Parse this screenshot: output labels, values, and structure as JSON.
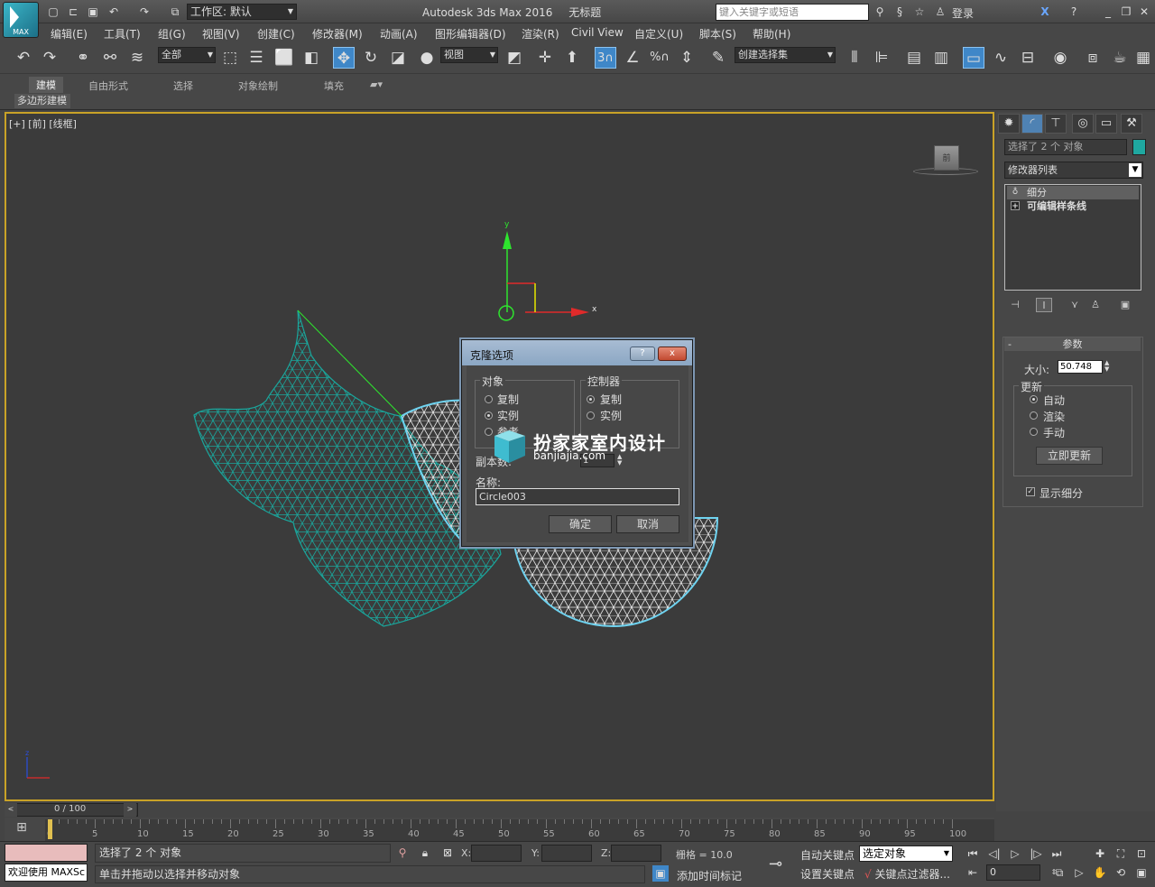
{
  "title_bar": {
    "logo_text": "MAX",
    "workspace_label": "工作区: 默认",
    "app_title": "Autodesk 3ds Max 2016",
    "doc_title": "无标题",
    "search_placeholder": "键入关键字或短语",
    "login_label": "登录"
  },
  "menu": [
    "编辑(E)",
    "工具(T)",
    "组(G)",
    "视图(V)",
    "创建(C)",
    "修改器(M)",
    "动画(A)",
    "图形编辑器(D)",
    "渲染(R)",
    "Civil View",
    "自定义(U)",
    "脚本(S)",
    "帮助(H)"
  ],
  "toolbar": {
    "filter_value": "全部",
    "ref_coord_value": "视图",
    "selection_set_placeholder": "创建选择集",
    "snap_number": "3"
  },
  "ribbon": {
    "tabs": [
      "建模",
      "自由形式",
      "选择",
      "对象绘制",
      "填充"
    ],
    "active_tab": "建模",
    "sub_panel": "多边形建模"
  },
  "viewport": {
    "label": "[+] [前] [线框]",
    "viewcube_face": "前",
    "gizmo_x": "x",
    "gizmo_y": "y",
    "corner_z": "z"
  },
  "command_panel": {
    "object_name": "选择了 2 个 对象",
    "object_color": "#1fa8a0",
    "modifier_list": "修改器列表",
    "stack": [
      {
        "label": "细分",
        "selected": true,
        "icon": "bulb-icon"
      },
      {
        "label": "可编辑样条线",
        "selected": false,
        "icon": "plus-icon"
      }
    ],
    "rollout_title": "参数",
    "size_label": "大小:",
    "size_value": "50.748",
    "update_title": "更新",
    "update_options": [
      "自动",
      "渲染",
      "手动"
    ],
    "update_selected": "自动",
    "update_now": "立即更新",
    "show_subdivision": "显示细分",
    "show_subdivision_checked": true
  },
  "clone_dialog": {
    "title": "克隆选项",
    "help_glyph": "?",
    "close_glyph": "x",
    "object_group": "对象",
    "object_options": [
      "复制",
      "实例",
      "参考"
    ],
    "object_selected": "实例",
    "controller_group": "控制器",
    "controller_options": [
      "复制",
      "实例"
    ],
    "controller_selected": "复制",
    "copies_label": "副本数:",
    "copies_value": "1",
    "name_label": "名称:",
    "name_value": "Circle003",
    "ok": "确定",
    "cancel": "取消"
  },
  "watermark": {
    "cn": "扮家家室内设计",
    "en": "banjiajia.com"
  },
  "timeline": {
    "slider_value": "0 / 100",
    "ticks": [
      0,
      5,
      10,
      15,
      20,
      25,
      30,
      35,
      40,
      45,
      50,
      55,
      60,
      65,
      70,
      75,
      80,
      85,
      90,
      95,
      100
    ],
    "range": [
      0,
      100
    ]
  },
  "status_bar": {
    "maxscript_label": "欢迎使用 MAXSc",
    "status_line1": "选择了 2 个 对象",
    "status_line2": "单击并拖动以选择并移动对象",
    "x_label": "X:",
    "y_label": "Y:",
    "z_label": "Z:",
    "grid": "栅格 = 10.0",
    "add_time_tag": "添加时间标记",
    "auto_key": "自动关键点",
    "set_key": "设置关键点",
    "selection_set": "选定对象",
    "key_filters": "关键点过滤器...",
    "current_frame": "0"
  }
}
